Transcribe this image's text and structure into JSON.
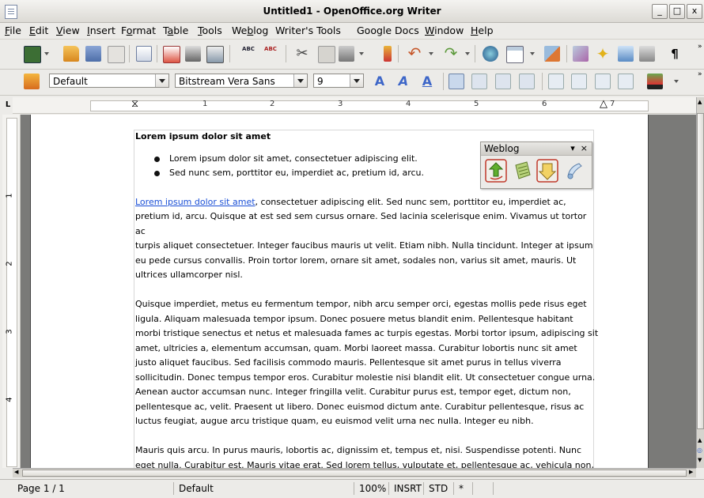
{
  "window": {
    "title": "Untitled1 - OpenOffice.org Writer",
    "minimize": "_",
    "maximize": "□",
    "close": "x"
  },
  "menu": [
    {
      "key": "F",
      "rest": "ile"
    },
    {
      "key": "E",
      "rest": "dit"
    },
    {
      "key": "V",
      "rest": "iew"
    },
    {
      "key": "I",
      "rest": "nsert"
    },
    {
      "pre": "F",
      "key": "o",
      "rest": "rmat"
    },
    {
      "pre": "T",
      "key": "a",
      "rest": "ble"
    },
    {
      "key": "T",
      "rest": "ools"
    },
    {
      "pre": "We",
      "key": "b",
      "rest": "log"
    },
    {
      "pre": "Writer's Tools",
      "key": "",
      "rest": ""
    },
    {
      "pre": "Google Docs",
      "key": "",
      "rest": ""
    },
    {
      "key": "W",
      "rest": "indow"
    },
    {
      "key": "H",
      "rest": "elp"
    }
  ],
  "formatting": {
    "paragraph_style": "Default",
    "font_name": "Bitstream Vera Sans",
    "font_size": "9"
  },
  "ruler": {
    "h_numbers": [
      "1",
      "2",
      "3",
      "4",
      "5",
      "6",
      "7"
    ],
    "v_numbers": [
      "1",
      "2",
      "3",
      "4"
    ]
  },
  "document": {
    "heading": "Lorem ipsum dolor sit amet",
    "bullets": [
      "Lorem ipsum dolor sit amet, consectetuer adipiscing elit.",
      "Sed nunc sem, porttitor eu, imperdiet ac, pretium id, arcu."
    ],
    "link_text": "Lorem ipsum dolor sit amet",
    "paragraph1_lines": [
      ", consectetuer adipiscing elit. Sed nunc sem, porttitor eu, imperdiet ac,",
      "pretium id, arcu. Quisque at est sed sem cursus ornare. Sed lacinia scelerisque enim. Vivamus ut tortor ac",
      "turpis aliquet consectetuer. Integer faucibus mauris ut velit. Etiam nibh. Nulla tincidunt. Integer at ipsum",
      "eu pede cursus convallis. Proin tortor lorem, ornare sit amet, sodales non, varius sit amet, mauris. Ut",
      "ultrices ullamcorper nisl."
    ],
    "paragraph2_lines": [
      "Quisque imperdiet, metus eu fermentum tempor, nibh arcu semper orci, egestas mollis pede risus eget",
      "ligula. Aliquam malesuada tempor ipsum. Donec posuere metus blandit enim. Pellentesque habitant",
      "morbi tristique senectus et netus et malesuada fames ac turpis egestas. Morbi tortor ipsum, adipiscing sit",
      "amet, ultricies a, elementum accumsan, quam. Morbi laoreet massa. Curabitur lobortis nunc sit amet",
      "justo aliquet faucibus. Sed facilisis commodo mauris. Pellentesque sit amet purus in tellus viverra",
      "sollicitudin. Donec tempus tempor eros. Curabitur molestie nisi blandit elit. Ut consectetuer congue urna.",
      "Aenean auctor accumsan nunc. Integer fringilla velit. Curabitur purus est, tempor eget, dictum non,",
      "pellentesque ac, velit. Praesent ut libero. Donec euismod dictum ante. Curabitur pellentesque, risus ac",
      "luctus feugiat, augue arcu tristique quam, eu euismod velit urna nec nulla. Integer eu nibh."
    ],
    "paragraph3_lines": [
      "Mauris quis arcu. In purus mauris, lobortis ac, dignissim et, tempus et, nisi. Suspendisse potenti. Nunc",
      "eget nulla. Curabitur est. Mauris vitae erat. Sed lorem tellus, vulputate et, pellentesque ac, vehicula non,"
    ]
  },
  "weblog_panel": {
    "title": "Weblog",
    "menu_glyph": "▾",
    "close_glyph": "×",
    "buttons": [
      "publish-icon",
      "edit-post-icon",
      "download-post-icon",
      "settings-icon"
    ]
  },
  "status": {
    "page": "Page 1 / 1",
    "style": "Default",
    "zoom": "100%",
    "insert_mode": "INSRT",
    "selection_mode": "STD",
    "modified": "*"
  },
  "colors": {
    "link": "#1a4fd6",
    "doc_background": "#7a7a78"
  }
}
